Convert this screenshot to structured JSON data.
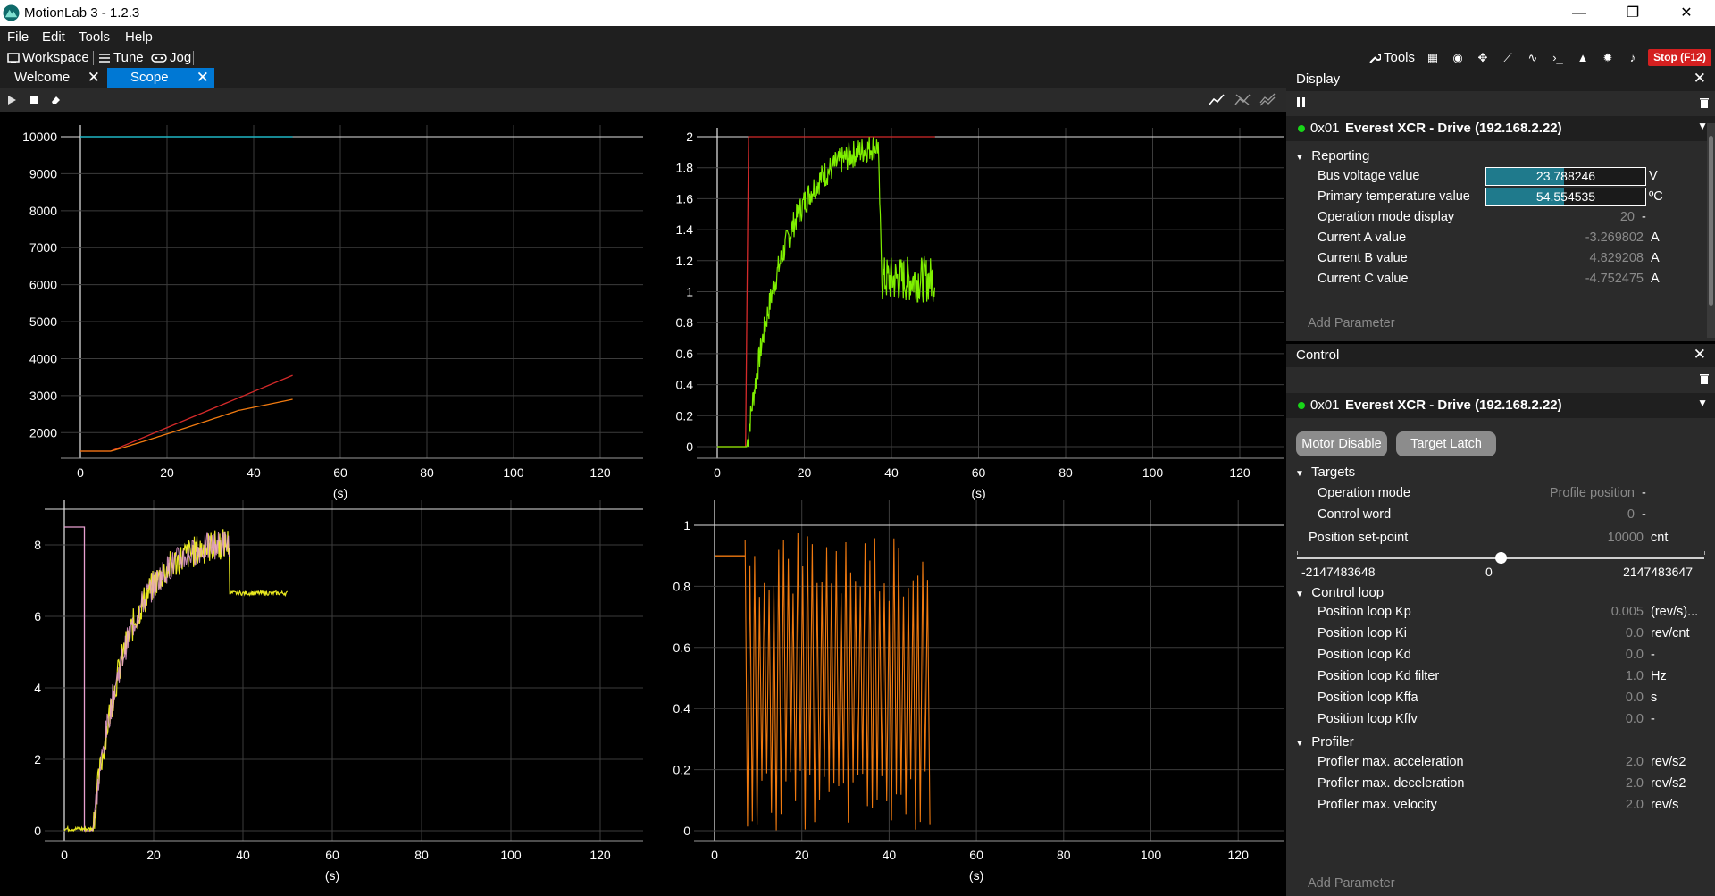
{
  "app": {
    "title": "MotionLab 3 - 1.2.3"
  },
  "window_controls": {
    "minimize": "—",
    "maximize": "❐",
    "close": "✕"
  },
  "menu": [
    "File",
    "Edit",
    "Tools",
    "Help"
  ],
  "toolbar": {
    "workspace": "Workspace",
    "tune": "Tune",
    "jog": "Jog",
    "tools": "Tools",
    "stop": "Stop (F12)",
    "icons": [
      "table-icon",
      "eye-icon",
      "move-icon",
      "chart-icon",
      "signal-icon",
      "terminal-icon",
      "warning-icon",
      "gear-icon",
      "bell-icon"
    ]
  },
  "tabs": [
    {
      "label": "Welcome",
      "active": false
    },
    {
      "label": "Scope",
      "active": true
    }
  ],
  "tab_close": "✕",
  "plots": [
    {
      "id": "plot-top-left",
      "x_ticks": [
        "0",
        "20",
        "40",
        "60",
        "80",
        "100",
        "120"
      ],
      "y_ticks": [
        "2000",
        "3000",
        "4000",
        "5000",
        "6000",
        "7000",
        "8000",
        "9000",
        "10000"
      ],
      "x_unit": "(s)"
    },
    {
      "id": "plot-top-right",
      "x_ticks": [
        "0",
        "20",
        "40",
        "60",
        "80",
        "100",
        "120"
      ],
      "y_ticks": [
        "0",
        "0.2",
        "0.4",
        "0.6",
        "0.8",
        "1",
        "1.2",
        "1.4",
        "1.6",
        "1.8",
        "2"
      ],
      "x_unit": "(s)"
    },
    {
      "id": "plot-bottom-left",
      "x_ticks": [
        "0",
        "20",
        "40",
        "60",
        "80",
        "100",
        "120"
      ],
      "y_ticks": [
        "0",
        "2",
        "4",
        "6",
        "8"
      ],
      "x_unit": "(s)"
    },
    {
      "id": "plot-bottom-right",
      "x_ticks": [
        "0",
        "20",
        "40",
        "60",
        "80",
        "100",
        "120"
      ],
      "y_ticks": [
        "0",
        "0.2",
        "0.4",
        "0.6",
        "0.8",
        "1"
      ],
      "x_unit": "(s)"
    }
  ],
  "display": {
    "title": "Display",
    "close": "✕",
    "device": {
      "address": "0x01",
      "name": "Everest XCR - Drive (192.168.2.22)"
    },
    "section": "Reporting",
    "rows": [
      {
        "label": "Bus voltage value",
        "value": "23.788246",
        "unit": "V",
        "bar": 0.49
      },
      {
        "label": "Primary temperature value",
        "value": "54.554535",
        "unit": "ºC",
        "bar": 0.49
      },
      {
        "label": "Operation mode display",
        "value": "20",
        "unit": "-"
      },
      {
        "label": "Current A value",
        "value": "-3.269802",
        "unit": "A"
      },
      {
        "label": "Current B value",
        "value": "4.829208",
        "unit": "A"
      },
      {
        "label": "Current C value",
        "value": "-4.752475",
        "unit": "A"
      }
    ],
    "add_parameter": "Add Parameter"
  },
  "control": {
    "title": "Control",
    "close": "✕",
    "device": {
      "address": "0x01",
      "name": "Everest XCR - Drive (192.168.2.22)"
    },
    "buttons": [
      "Motor Disable",
      "Target Latch"
    ],
    "targets": {
      "section": "Targets",
      "rows": [
        {
          "label": "Operation mode",
          "value": "Profile position",
          "unit": "-"
        },
        {
          "label": "Control word",
          "value": "0",
          "unit": "-"
        }
      ],
      "setpoint": {
        "label": "Position set-point",
        "value": "10000",
        "unit": "cnt",
        "min": "-2147483648",
        "mid": "0",
        "max": "2147483647",
        "position": 0.5
      }
    },
    "control_loop": {
      "section": "Control loop",
      "rows": [
        {
          "label": "Position loop Kp",
          "value": "0.005",
          "unit": "(rev/s)..."
        },
        {
          "label": "Position loop Ki",
          "value": "0.0",
          "unit": "rev/cnt"
        },
        {
          "label": "Position loop Kd",
          "value": "0.0",
          "unit": "-"
        },
        {
          "label": "Position loop Kd filter",
          "value": "1.0",
          "unit": "Hz"
        },
        {
          "label": "Position loop Kffa",
          "value": "0.0",
          "unit": "s"
        },
        {
          "label": "Position loop Kffv",
          "value": "0.0",
          "unit": "-"
        }
      ]
    },
    "profiler": {
      "section": "Profiler",
      "rows": [
        {
          "label": "Profiler max. acceleration",
          "value": "2.0",
          "unit": "rev/s2"
        },
        {
          "label": "Profiler max. deceleration",
          "value": "2.0",
          "unit": "rev/s2"
        },
        {
          "label": "Profiler max. velocity",
          "value": "2.0",
          "unit": "rev/s"
        }
      ]
    },
    "add_parameter": "Add Parameter"
  },
  "colors": {
    "accent": "#0078d4",
    "stop": "#d42020",
    "online": "#18d618",
    "bar_fill": "#1f7a8c",
    "trace_cyan": "#1fb5c4",
    "trace_red": "#d42a2a",
    "trace_orange": "#f07a10",
    "trace_green": "#7ff000",
    "trace_yellow": "#e8e820",
    "trace_pink": "#e8a0d0"
  }
}
